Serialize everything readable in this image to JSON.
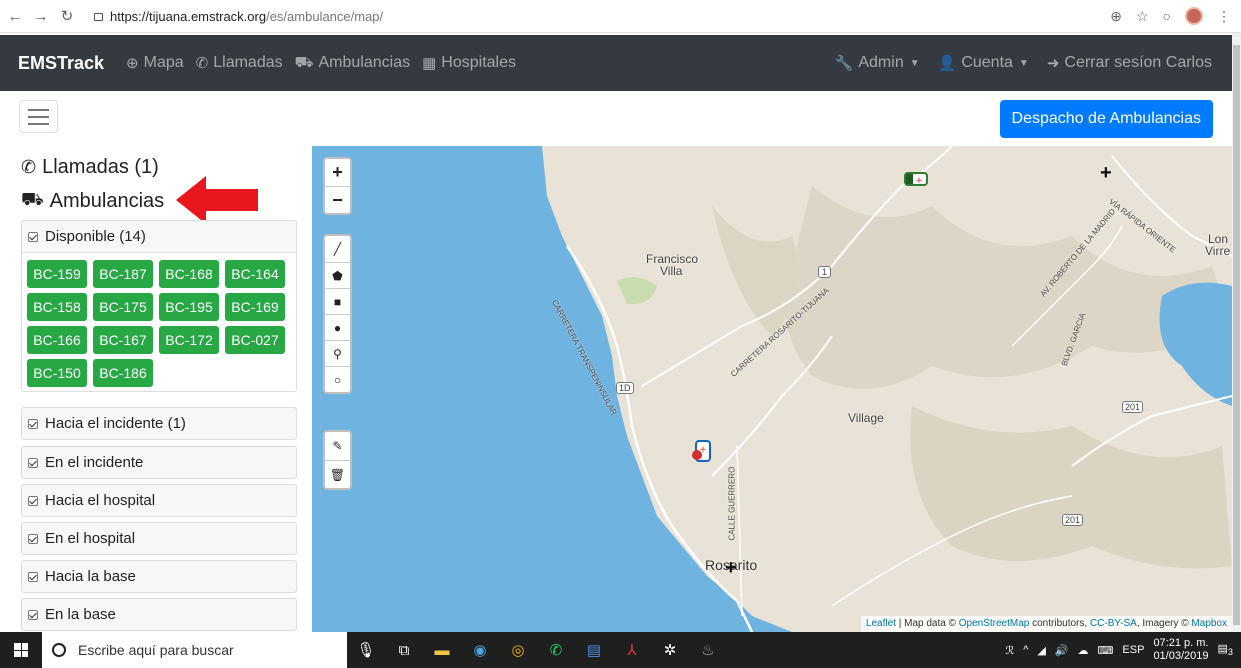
{
  "browser": {
    "url_host": "https://tijuana.emstrack.org",
    "url_path": "/es/ambulance/map/"
  },
  "navbar": {
    "brand": "EMSTrack",
    "items": [
      {
        "label": "Mapa",
        "icon": "globe-icon"
      },
      {
        "label": "Llamadas",
        "icon": "phone-icon"
      },
      {
        "label": "Ambulancias",
        "icon": "ambulance-icon"
      },
      {
        "label": "Hospitales",
        "icon": "hospital-icon"
      }
    ],
    "admin": "Admin",
    "account": "Cuenta",
    "logout": "Cerrar sesíon Carlos"
  },
  "toolbar": {
    "dispatch_label": "Despacho de Ambulancias"
  },
  "sidebar": {
    "calls_title": "Llamadas (1)",
    "ambulances_title": "Ambulancias",
    "groups": [
      {
        "label": "Disponible (14)"
      },
      {
        "label": "Hacia el incidente (1)"
      },
      {
        "label": "En el incidente"
      },
      {
        "label": "Hacia el hospital"
      },
      {
        "label": "En el hospital"
      },
      {
        "label": "Hacia la base"
      },
      {
        "label": "En la base"
      }
    ],
    "available_units": [
      "BC-159",
      "BC-187",
      "BC-168",
      "BC-164",
      "BC-158",
      "BC-175",
      "BC-195",
      "BC-169",
      "BC-166",
      "BC-167",
      "BC-172",
      "BC-027",
      "BC-150",
      "BC-186"
    ],
    "available_color": "#28a745"
  },
  "map": {
    "labels": {
      "francisco": "Francisco",
      "villa": "Villa",
      "village": "Village",
      "rosarito": "Rosarito",
      "lon": "Lon",
      "virre": "Virre",
      "carretera": "CARRETERA TRANSPENINSULAR",
      "rosarito_road": "CARRETERA ROSARITO-TIJUANA",
      "via_rapida": "VÍA RÁPIDA ORIENTE",
      "av_roberto": "AV. ROBERTO DE LA MADRID",
      "blvd_garcia": "BLVD. GARCIA",
      "calle_guerrero": "CALLE GUERRERO",
      "shield_1": "1",
      "shield_1d": "1D",
      "shield_201a": "201",
      "shield_201b": "201"
    },
    "attribution": {
      "leaflet": "Leaflet",
      "mapdata": " | Map data © ",
      "osm": "OpenStreetMap",
      "contrib": " contributors, ",
      "ccbysa": "CC-BY-SA",
      "imagery": ", Imagery © ",
      "mapbox": "Mapbox"
    },
    "water_color": "#6fb3e0",
    "land_color": "#e8e3d6"
  },
  "taskbar": {
    "search_placeholder": "Escribe aquí para buscar",
    "lang": "ESP",
    "time": "07:21 p. m.",
    "date": "01/03/2019",
    "notifications": "3"
  }
}
